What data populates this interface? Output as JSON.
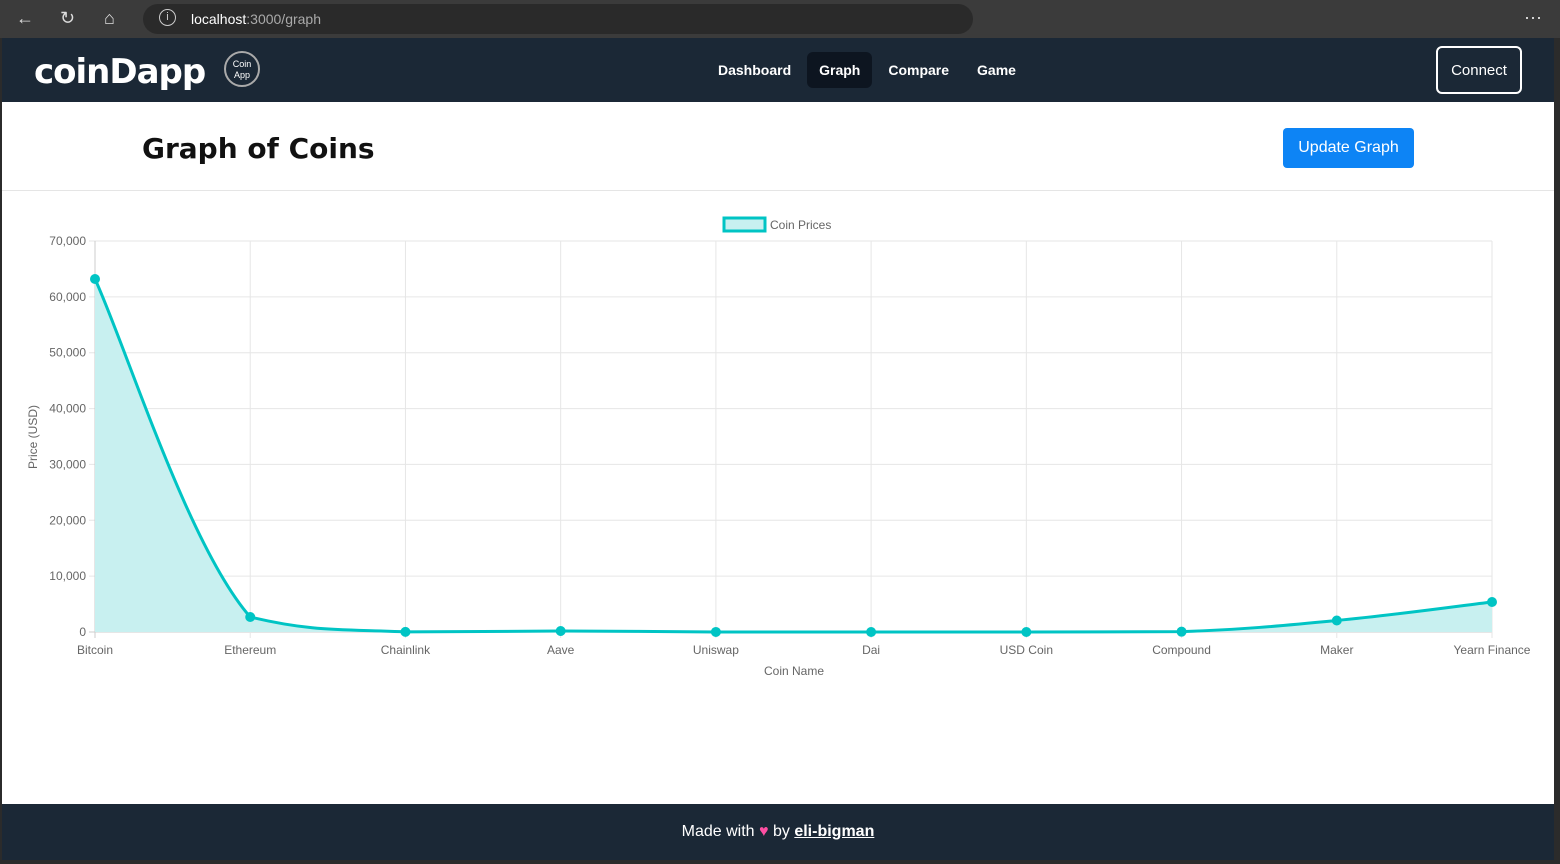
{
  "browser": {
    "url_host": "localhost",
    "url_path": ":3000/graph"
  },
  "nav": {
    "logo": "coinDapp",
    "badge_line1": "Coin",
    "badge_line2": "App",
    "links": [
      "Dashboard",
      "Graph",
      "Compare",
      "Game"
    ],
    "active": "Graph",
    "connect": "Connect"
  },
  "header": {
    "title": "Graph of Coins",
    "update_button": "Update Graph"
  },
  "chart_data": {
    "type": "line",
    "legend": "Coin Prices",
    "legend_position": "top",
    "xlabel": "Coin Name",
    "ylabel": "Price (USD)",
    "categories": [
      "Bitcoin",
      "Ethereum",
      "Chainlink",
      "Aave",
      "Uniswap",
      "Dai",
      "USD Coin",
      "Compound",
      "Maker",
      "Yearn Finance"
    ],
    "values": [
      63200,
      2690,
      20,
      180,
      8,
      1,
      1,
      60,
      2060,
      5370
    ],
    "ylim": [
      0,
      70000
    ],
    "yticks": [
      "0",
      "10,000",
      "20,000",
      "30,000",
      "40,000",
      "50,000",
      "60,000",
      "70,000"
    ],
    "grid": true,
    "fill": true,
    "color": "#00c4c4",
    "fill_color": "#c8f0f0"
  },
  "footer": {
    "made_with": "Made with",
    "heart": "♥",
    "by": "by",
    "author": "eli-bigman"
  }
}
